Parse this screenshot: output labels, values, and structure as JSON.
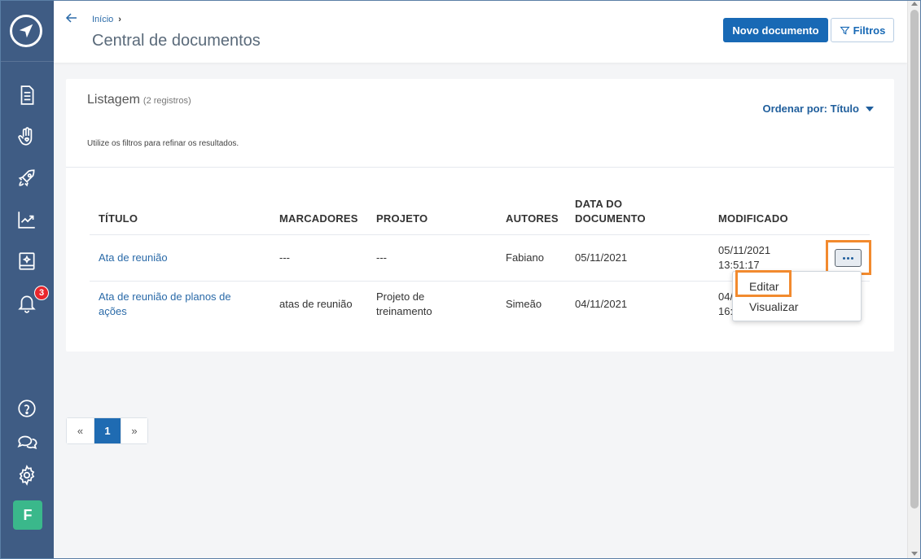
{
  "breadcrumb": {
    "home": "Início",
    "separator": "›"
  },
  "header": {
    "title": "Central de documentos",
    "new_button": "Novo documento",
    "filter_button": "Filtros"
  },
  "listing": {
    "title": "Listagem",
    "count": "(2 registros)",
    "sort_label": "Ordenar por: Título",
    "hint": "Utilize os filtros para refinar os resultados."
  },
  "table": {
    "columns": [
      "TÍTULO",
      "MARCADORES",
      "PROJETO",
      "AUTORES",
      "DATA DO DOCUMENTO",
      "MODIFICADO"
    ],
    "rows": [
      {
        "title": "Ata de reunião",
        "tags": "---",
        "project": "---",
        "authors": "Fabiano",
        "date": "05/11/2021",
        "modified": "05/11/2021 13:51:17"
      },
      {
        "title": "Ata de reunião de planos de ações",
        "tags": "atas de reunião",
        "project": "Projeto de treinamento",
        "authors": "Simeão",
        "date": "04/11/2021",
        "modified": "04/11/2021 16:"
      }
    ]
  },
  "row_menu": {
    "items": [
      "Editar",
      "Visualizar"
    ]
  },
  "pagination": {
    "prev": "«",
    "current": "1",
    "next": "»"
  },
  "notifications": {
    "count": "3"
  },
  "user": {
    "initial": "F"
  },
  "colors": {
    "sidebar": "#3f5c84",
    "primary": "#1869b5",
    "highlight": "#f28a2e",
    "badge": "#e8262d",
    "avatar": "#3ab88b"
  }
}
